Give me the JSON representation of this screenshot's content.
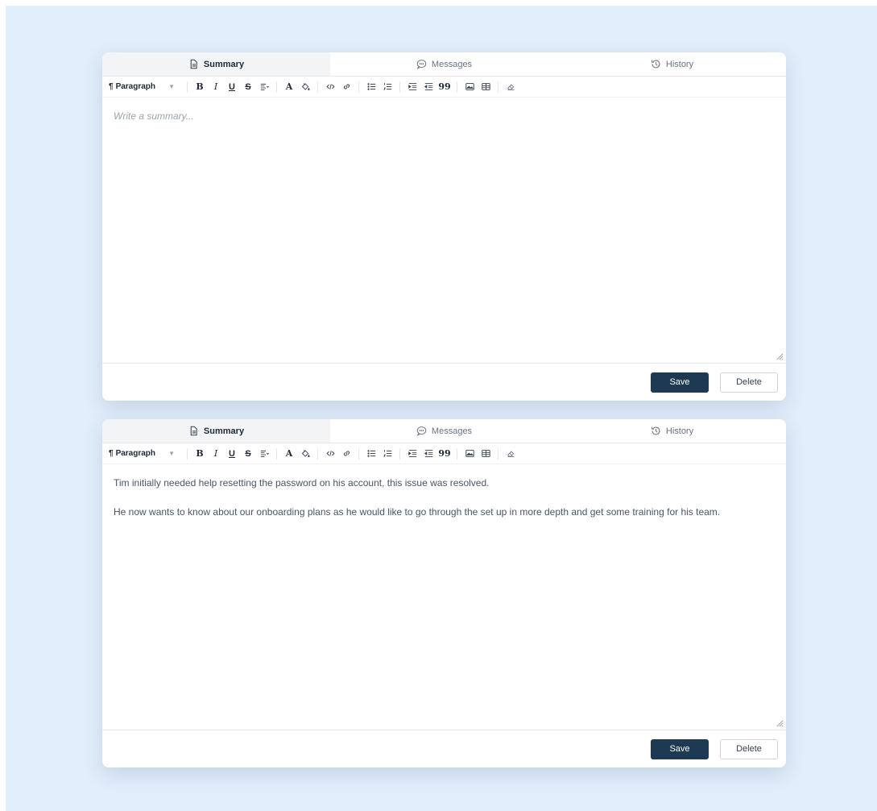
{
  "tabs": {
    "summary": "Summary",
    "messages": "Messages",
    "history": "History"
  },
  "toolbar": {
    "paragraph": "Paragraph",
    "pilcrow": "¶",
    "bold": "B",
    "italic": "I",
    "underline": "U",
    "strike": "S",
    "text_color": "A",
    "quote": "99"
  },
  "panel1": {
    "placeholder": "Write a summary..."
  },
  "panel2": {
    "paragraphs": [
      "Tim initially needed help resetting the password on his account, this issue was resolved.",
      "He now wants to know about our onboarding plans as he would like to go through the set up in more depth and get some training for his team."
    ]
  },
  "buttons": {
    "save": "Save",
    "delete": "Delete"
  },
  "colors": {
    "background": "#e1eefb",
    "save_button": "#1e3a52",
    "active_tab": "#f3f4f6"
  }
}
